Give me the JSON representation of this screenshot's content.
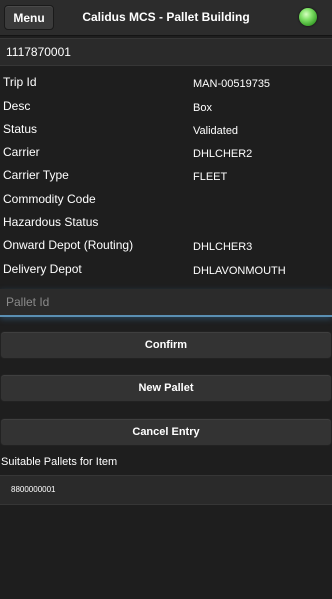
{
  "header": {
    "menu_label": "Menu",
    "title": "Calidus MCS - Pallet Building",
    "status_color": "#5fd14a"
  },
  "item": {
    "id": "1117870001"
  },
  "details": [
    {
      "label": "Trip Id",
      "value": "MAN-00519735"
    },
    {
      "label": "Desc",
      "value": "Box"
    },
    {
      "label": "Status",
      "value": "Validated"
    },
    {
      "label": "Carrier",
      "value": "DHLCHER2"
    },
    {
      "label": "Carrier Type",
      "value": "FLEET"
    },
    {
      "label": "Commodity Code",
      "value": ""
    },
    {
      "label": "Hazardous Status",
      "value": ""
    },
    {
      "label": "Onward Depot (Routing)",
      "value": "DHLCHER3"
    },
    {
      "label": "Delivery Depot",
      "value": "DHLAVONMOUTH"
    }
  ],
  "pallet_input": {
    "placeholder": "Pallet Id",
    "value": ""
  },
  "buttons": {
    "confirm": "Confirm",
    "new_pallet": "New Pallet",
    "cancel_entry": "Cancel Entry"
  },
  "suitable": {
    "title": "Suitable Pallets for Item",
    "items": [
      "8800000001"
    ]
  }
}
